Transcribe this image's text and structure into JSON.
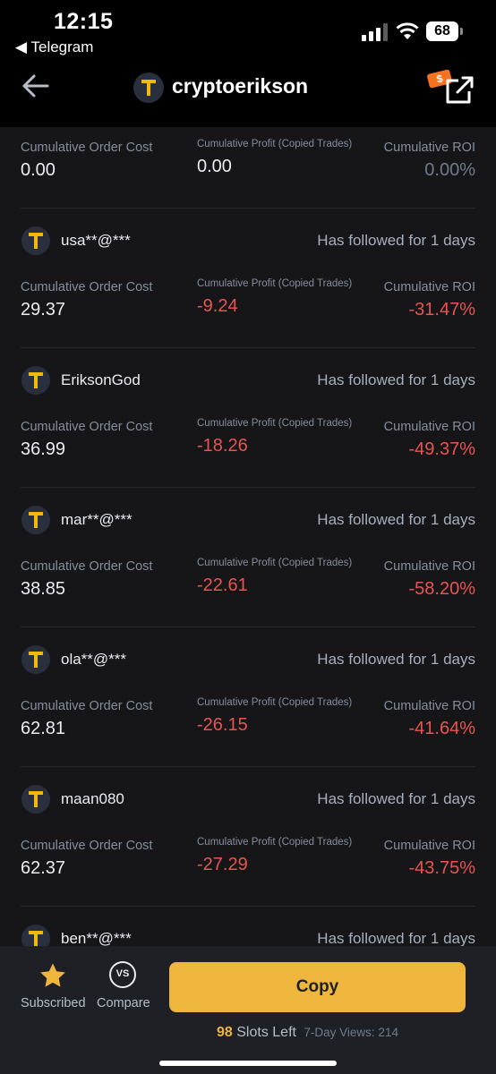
{
  "status_bar": {
    "time": "12:15",
    "back_app": "◀ Telegram",
    "battery": "68"
  },
  "header": {
    "title": "cryptoerikson",
    "share_tag": "$"
  },
  "labels": {
    "cost": "Cumulative Order Cost",
    "profit": "Cumulative Profit (Copied Trades)",
    "roi": "Cumulative ROI",
    "avatar_letter": "T"
  },
  "summary": {
    "cost": "0.00",
    "profit": "0.00",
    "roi": "0.00%"
  },
  "followers": [
    {
      "name": "usa**@***",
      "followed": "Has followed for 1 days",
      "cost": "29.37",
      "profit": "-9.24",
      "roi": "-31.47%"
    },
    {
      "name": "EriksonGod",
      "followed": "Has followed for 1 days",
      "cost": "36.99",
      "profit": "-18.26",
      "roi": "-49.37%"
    },
    {
      "name": "mar**@***",
      "followed": "Has followed for 1 days",
      "cost": "38.85",
      "profit": "-22.61",
      "roi": "-58.20%"
    },
    {
      "name": "ola**@***",
      "followed": "Has followed for 1 days",
      "cost": "62.81",
      "profit": "-26.15",
      "roi": "-41.64%"
    },
    {
      "name": "maan080",
      "followed": "Has followed for 1 days",
      "cost": "62.37",
      "profit": "-27.29",
      "roi": "-43.75%"
    },
    {
      "name": "ben**@***",
      "followed": "Has followed for 1 days",
      "cost": "",
      "profit": "",
      "roi": ""
    }
  ],
  "bottom": {
    "subscribed": "Subscribed",
    "compare": "Compare",
    "vs": "VS",
    "copy": "Copy",
    "slots_num": "98",
    "slots_text": "Slots Left",
    "views": "7-Day Views: 214"
  },
  "colors": {
    "accent": "#efb63d",
    "negative": "#e8544f",
    "background": "#161619"
  }
}
